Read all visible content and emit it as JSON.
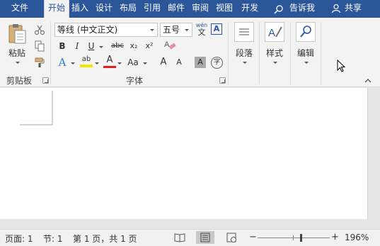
{
  "tabs": [
    {
      "label": "文件"
    },
    {
      "label": "开始"
    },
    {
      "label": "插入"
    },
    {
      "label": "设计"
    },
    {
      "label": "布局"
    },
    {
      "label": "引用"
    },
    {
      "label": "邮件"
    },
    {
      "label": "审阅"
    },
    {
      "label": "视图"
    },
    {
      "label": "开发"
    }
  ],
  "tell_me": "告诉我",
  "share": "共享",
  "clipboard": {
    "paste_label": "粘贴",
    "group_label": "剪贴板"
  },
  "font": {
    "font_name": "等线 (中文正文)",
    "font_size": "五号",
    "wen": "wén",
    "wen_char": "文",
    "boxed_a": "A",
    "bold": "B",
    "italic": "I",
    "underline": "U",
    "strike": "abc",
    "subscript": "x₂",
    "superscript": "x²",
    "text_effects": "A",
    "highlight": "ab",
    "font_color": "A",
    "change_case": "Aa",
    "grow": "A",
    "shrink": "A",
    "shading": "A",
    "enclose": "字",
    "group_label": "字体",
    "highlight_color": "#f2e600",
    "font_color_value": "#e01e1e"
  },
  "paragraph": {
    "label": "段落"
  },
  "styles": {
    "label": "样式"
  },
  "editing": {
    "label": "编辑"
  },
  "status": {
    "page": "页面: 1",
    "section": "节: 1",
    "page_of": "第 1 页，共 1 页",
    "zoom_minus": "−",
    "zoom_plus": "+",
    "zoom": "196%",
    "zoom_level_percent": 196
  },
  "colors": {
    "title_bar": "#2b579a",
    "ribbon": "#f3f3f3",
    "page": "#ffffff"
  }
}
